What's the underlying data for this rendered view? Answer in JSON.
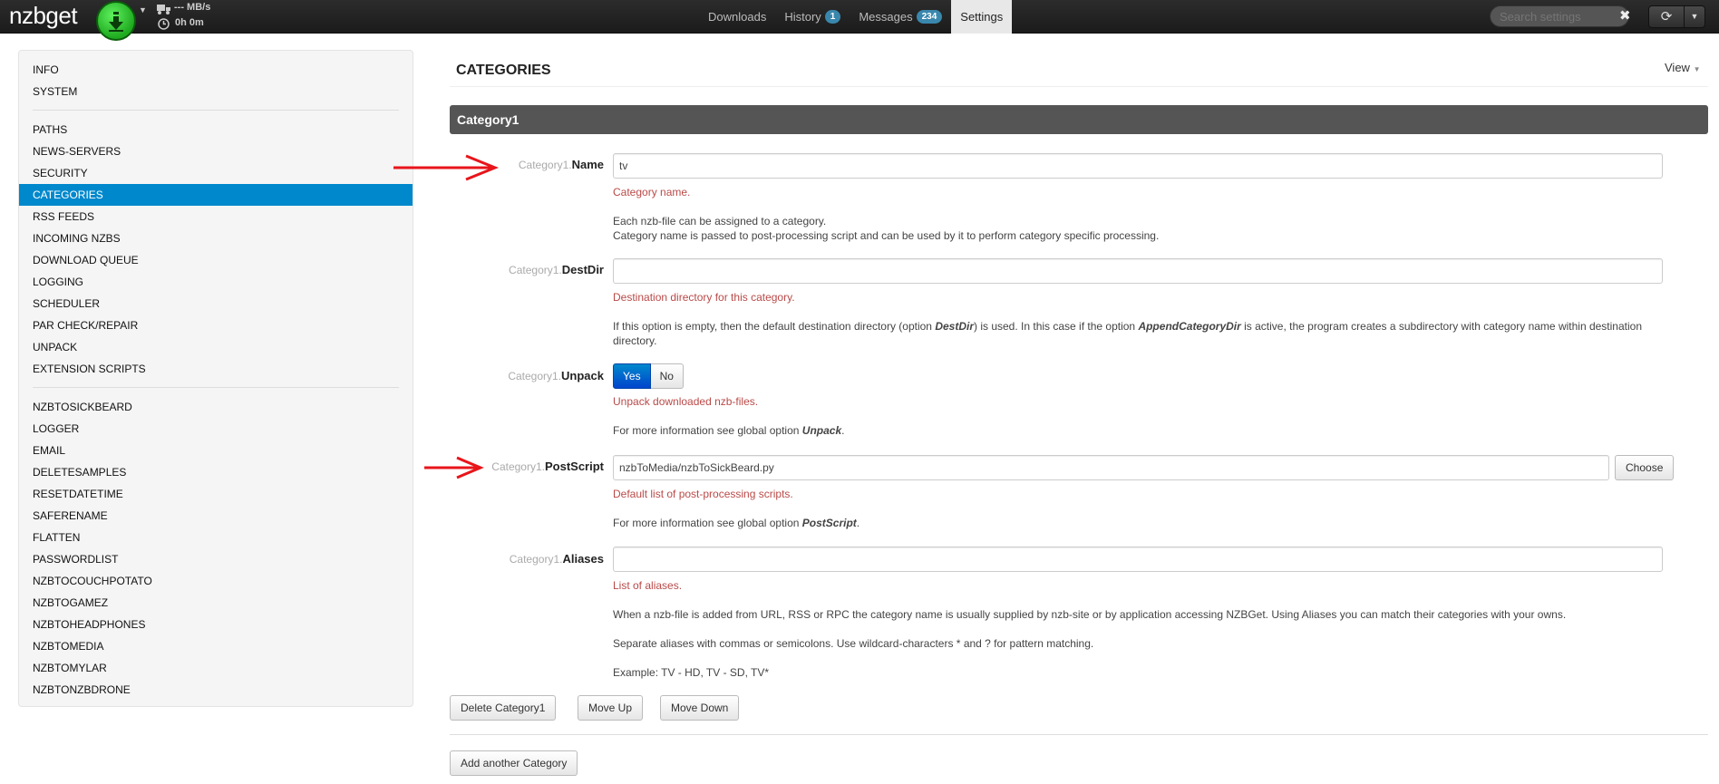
{
  "topbar": {
    "logo": "nzbget",
    "speed": "--- MB/s",
    "time": "0h 0m",
    "nav": [
      {
        "label": "Downloads",
        "badge": ""
      },
      {
        "label": "History",
        "badge": "1"
      },
      {
        "label": "Messages",
        "badge": "234"
      },
      {
        "label": "Settings",
        "badge": ""
      }
    ],
    "search_placeholder": "Search settings"
  },
  "sidebar": {
    "group1": [
      "INFO",
      "SYSTEM"
    ],
    "group2": [
      "PATHS",
      "NEWS-SERVERS",
      "SECURITY",
      "CATEGORIES",
      "RSS FEEDS",
      "INCOMING NZBS",
      "DOWNLOAD QUEUE",
      "LOGGING",
      "SCHEDULER",
      "PAR CHECK/REPAIR",
      "UNPACK",
      "EXTENSION SCRIPTS"
    ],
    "group3": [
      "NZBTOSICKBEARD",
      "LOGGER",
      "EMAIL",
      "DELETESAMPLES",
      "RESETDATETIME",
      "SAFERENAME",
      "FLATTEN",
      "PASSWORDLIST",
      "NZBTOCOUCHPOTATO",
      "NZBTOGAMEZ",
      "NZBTOHEADPHONES",
      "NZBTOMEDIA",
      "NZBTOMYLAR",
      "NZBTONZBDRONE"
    ],
    "active": "CATEGORIES"
  },
  "main": {
    "title": "CATEGORIES",
    "view_label": "View",
    "section": "Category1",
    "name": {
      "prefix": "Category1.",
      "label": "Name",
      "value": "tv",
      "hint": "Category name.",
      "desc1": "Each nzb-file can be assigned to a category.",
      "desc2": "Category name is passed to post-processing script and can be used by it to perform category specific processing."
    },
    "destdir": {
      "prefix": "Category1.",
      "label": "DestDir",
      "value": "",
      "hint": "Destination directory for this category.",
      "desc_a": "If this option is empty, then the default destination directory (option ",
      "desc_b": "DestDir",
      "desc_c": ") is used. In this case if the option ",
      "desc_d": "AppendCategoryDir",
      "desc_e": " is active, the program creates a subdirectory with category name within destination directory."
    },
    "unpack": {
      "prefix": "Category1.",
      "label": "Unpack",
      "yes": "Yes",
      "no": "No",
      "selected": "Yes",
      "hint": "Unpack downloaded nzb-files.",
      "desc_a": "For more information see global option ",
      "desc_b": "Unpack",
      "desc_c": "."
    },
    "postscript": {
      "prefix": "Category1.",
      "label": "PostScript",
      "value": "nzbToMedia/nzbToSickBeard.py",
      "choose": "Choose",
      "hint": "Default list of post-processing scripts.",
      "desc_a": "For more information see global option ",
      "desc_b": "PostScript",
      "desc_c": "."
    },
    "aliases": {
      "prefix": "Category1.",
      "label": "Aliases",
      "value": "",
      "hint": "List of aliases.",
      "desc1": "When a nzb-file is added from URL, RSS or RPC the category name is usually supplied by nzb-site or by application accessing NZBGet. Using Aliases you can match their categories with your owns.",
      "desc2": "Separate aliases with commas or semicolons. Use wildcard-characters * and ? for pattern matching.",
      "desc3": "Example: TV - HD, TV - SD, TV*"
    },
    "buttons": {
      "delete": "Delete Category1",
      "move_up": "Move Up",
      "move_down": "Move Down",
      "add": "Add another Category"
    }
  },
  "colors": {
    "accent": "#0088cc",
    "hint": "#b94a48",
    "annotation_arrow": "#e8151b"
  }
}
